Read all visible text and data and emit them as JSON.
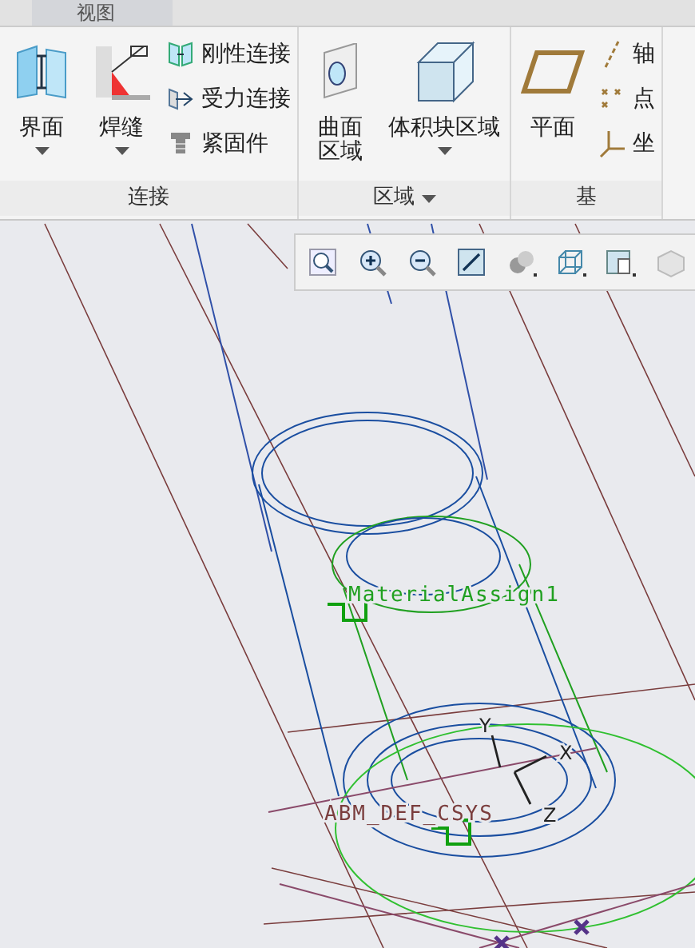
{
  "tabs": [
    {
      "label": "视图",
      "selected": false
    }
  ],
  "ribbon": {
    "groups": [
      {
        "label": "连接",
        "has_menu": false,
        "buttons": [
          {
            "kind": "large",
            "label": "界面",
            "has_menu": true
          },
          {
            "kind": "large",
            "label": "焊缝",
            "has_menu": true
          },
          {
            "kind": "small",
            "label": "刚性连接"
          },
          {
            "kind": "small",
            "label": "受力连接"
          },
          {
            "kind": "small",
            "label": "紧固件"
          }
        ]
      },
      {
        "label": "区域",
        "has_menu": true,
        "buttons": [
          {
            "kind": "large",
            "label": "曲面区域",
            "has_menu": false
          },
          {
            "kind": "large",
            "label": "体积块区域",
            "has_menu": true
          }
        ]
      },
      {
        "label": "基",
        "has_menu": false,
        "buttons": [
          {
            "kind": "large",
            "label": "平面",
            "has_menu": false
          },
          {
            "kind": "small",
            "label": "轴"
          },
          {
            "kind": "small",
            "label": "点"
          },
          {
            "kind": "small",
            "label": "坐"
          }
        ]
      }
    ]
  },
  "model_labels": [
    {
      "text": "MaterialAssign1"
    },
    {
      "text": "Y"
    },
    {
      "text": "X"
    },
    {
      "text": "Z"
    },
    {
      "text": "ABM_DEF_CSYS"
    }
  ]
}
